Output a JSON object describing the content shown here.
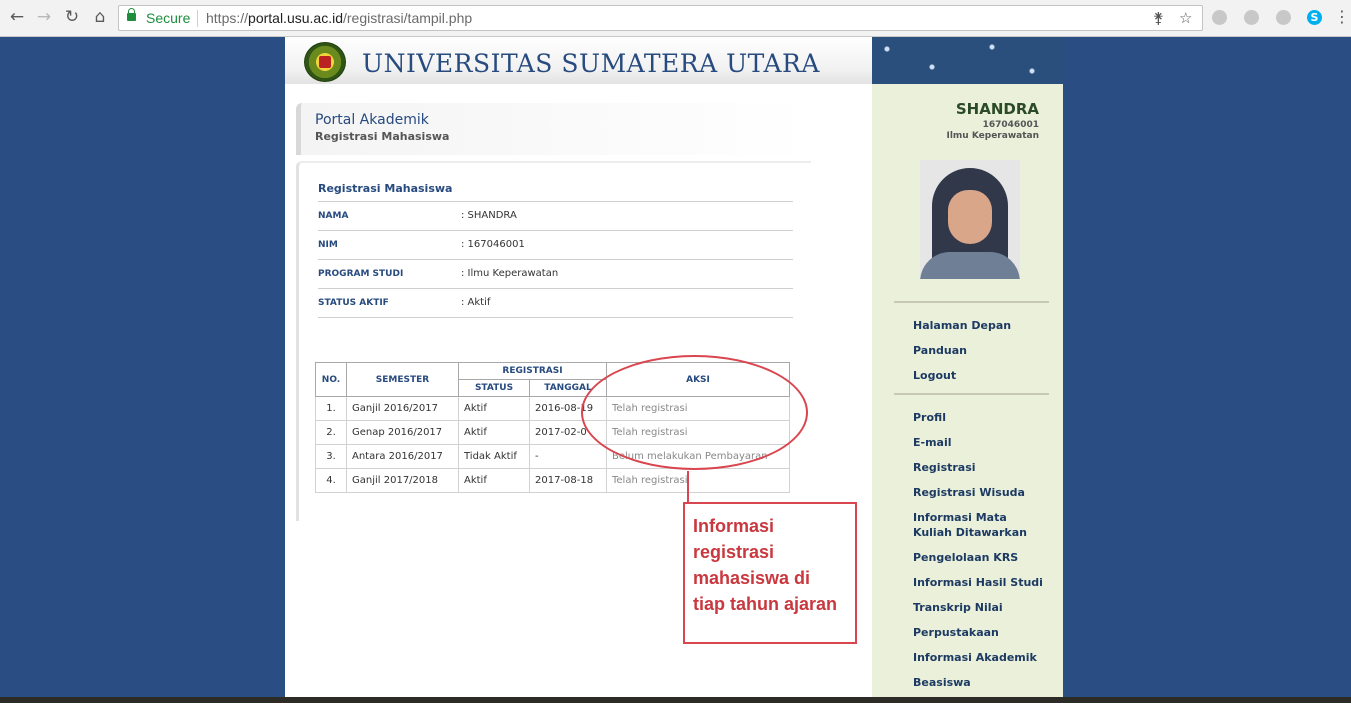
{
  "browser": {
    "secure_label": "Secure",
    "url_scheme": "https://",
    "url_host": "portal.usu.ac.id",
    "url_path": "/registrasi/tampil.php"
  },
  "header": {
    "university": "UNIVERSITAS SUMATERA UTARA"
  },
  "page_title": {
    "title": "Portal Akademik",
    "subtitle": "Registrasi Mahasiswa"
  },
  "section_title": "Registrasi Mahasiswa",
  "student_info": [
    {
      "label": "NAMA",
      "value": ": SHANDRA"
    },
    {
      "label": "NIM",
      "value": ": 167046001"
    },
    {
      "label": "PROGRAM STUDI",
      "value": ": Ilmu Keperawatan"
    },
    {
      "label": "STATUS AKTIF",
      "value": ": Aktif"
    }
  ],
  "table": {
    "headers": {
      "no": "NO.",
      "semester": "SEMESTER",
      "registrasi": "REGISTRASI",
      "status": "STATUS",
      "tanggal": "TANGGAL",
      "aksi": "AKSI"
    },
    "rows": [
      {
        "no": "1.",
        "semester": "Ganjil 2016/2017",
        "status": "Aktif",
        "tanggal": "2016-08-19",
        "aksi": "Telah registrasi"
      },
      {
        "no": "2.",
        "semester": "Genap 2016/2017",
        "status": "Aktif",
        "tanggal": "2017-02-0",
        "aksi": "Telah registrasi"
      },
      {
        "no": "3.",
        "semester": "Antara 2016/2017",
        "status": "Tidak Aktif",
        "tanggal": "-",
        "aksi": "Belum melakukan Pembayaran"
      },
      {
        "no": "4.",
        "semester": "Ganjil 2017/2018",
        "status": "Aktif",
        "tanggal": "2017-08-18",
        "aksi": "Telah registrasi"
      }
    ]
  },
  "annotation": {
    "text": "Informasi registrasi mahasiswa di tiap tahun ajaran",
    "color": "#d9464f"
  },
  "sidebar": {
    "name": "SHANDRA",
    "nim": "167046001",
    "prodi": "Ilmu Keperawatan",
    "menu_top": [
      "Halaman Depan",
      "Panduan",
      "Logout"
    ],
    "menu_main": [
      "Profil",
      "E-mail",
      "Registrasi",
      "Registrasi Wisuda",
      "Informasi Mata Kuliah Ditawarkan",
      "Pengelolaan KRS",
      "Informasi Hasil Studi",
      "Transkrip Nilai",
      "Perpustakaan",
      "Informasi Akademik",
      "Beasiswa"
    ]
  },
  "colors": {
    "background": "#2a4d84",
    "sidebar": "#eaf0da",
    "link": "#1d3a63",
    "title": "#274a7f"
  }
}
